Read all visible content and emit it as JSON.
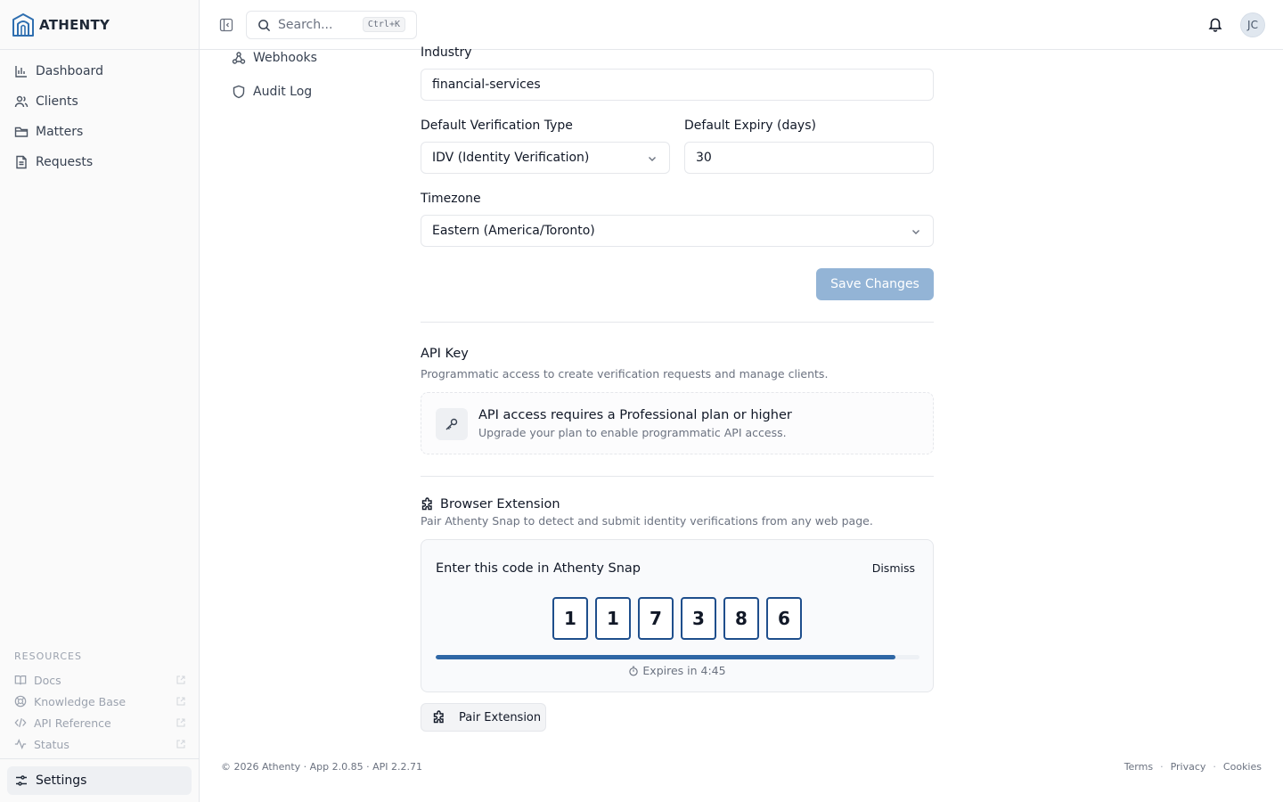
{
  "brand": {
    "name": "ATHENTY"
  },
  "sidebar": {
    "nav": [
      {
        "label": "Dashboard",
        "icon": "bar-chart-icon"
      },
      {
        "label": "Clients",
        "icon": "users-icon"
      },
      {
        "label": "Matters",
        "icon": "folder-icon"
      },
      {
        "label": "Requests",
        "icon": "file-icon"
      }
    ],
    "resources_label": "RESOURCES",
    "resources": [
      {
        "label": "Docs",
        "icon": "book-icon"
      },
      {
        "label": "Knowledge Base",
        "icon": "lifebuoy-icon"
      },
      {
        "label": "API Reference",
        "icon": "code-icon"
      },
      {
        "label": "Status",
        "icon": "activity-icon"
      }
    ],
    "settings_label": "Settings"
  },
  "topbar": {
    "search_placeholder": "Search...",
    "search_shortcut": "Ctrl+K",
    "avatar_initials": "JC"
  },
  "subnav": [
    {
      "label": "Webhooks",
      "icon": "webhook-icon"
    },
    {
      "label": "Audit Log",
      "icon": "shield-icon"
    }
  ],
  "form": {
    "industry_label": "Industry",
    "industry_value": "financial-services",
    "verification_type_label": "Default Verification Type",
    "verification_type_value": "IDV (Identity Verification)",
    "expiry_label": "Default Expiry (days)",
    "expiry_value": "30",
    "timezone_label": "Timezone",
    "timezone_value": "Eastern (America/Toronto)",
    "save_label": "Save Changes"
  },
  "api_key": {
    "title": "API Key",
    "subtitle": "Programmatic access to create verification requests and manage clients.",
    "notice_title": "API access requires a Professional plan or higher",
    "notice_subtitle": "Upgrade your plan to enable programmatic API access."
  },
  "extension": {
    "title": "Browser Extension",
    "subtitle": "Pair Athenty Snap to detect and submit identity verifications from any web page.",
    "card_title": "Enter this code in Athenty Snap",
    "dismiss_label": "Dismiss",
    "code": [
      "1",
      "1",
      "7",
      "3",
      "8",
      "6"
    ],
    "progress_fraction": 0.95,
    "expires_text": "Expires in 4:45",
    "pair_label": "Pair Extension"
  },
  "footer": {
    "copyright": "© 2026 Athenty · App 2.0.85 · API 2.2.71",
    "links": [
      "Terms",
      "Privacy",
      "Cookies"
    ],
    "separator": "·"
  },
  "colors": {
    "accent": "#2f67a6",
    "code_border": "#1e4e8c",
    "save_disabled": "#93b4d6"
  }
}
